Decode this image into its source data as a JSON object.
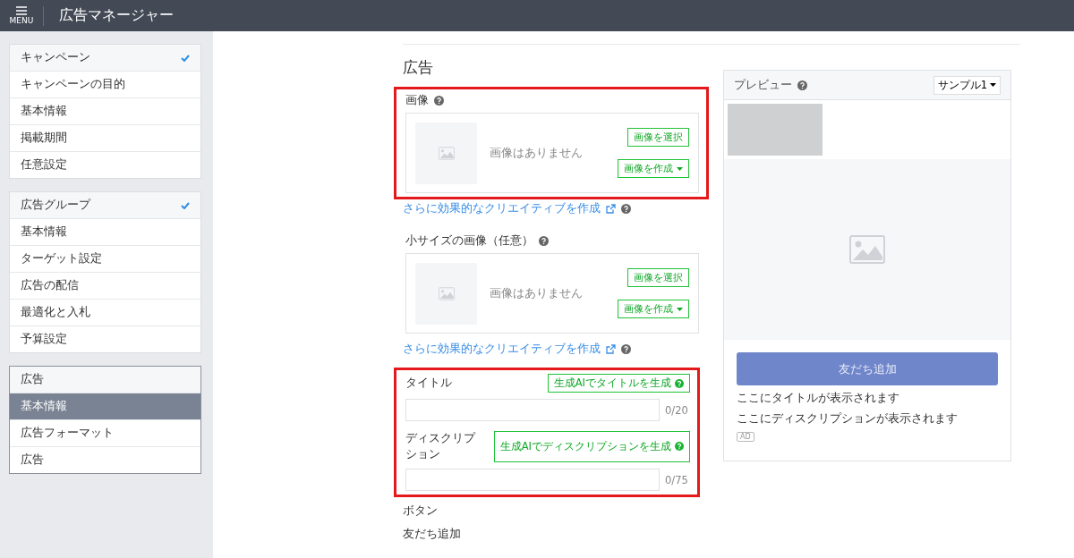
{
  "header": {
    "menu_label": "MENU",
    "title": "広告マネージャー"
  },
  "sidebar": {
    "groups": [
      {
        "title": "キャンペーン",
        "checked": true,
        "boxed": false,
        "items": [
          {
            "label": "キャンペーンの目的",
            "selected": false
          },
          {
            "label": "基本情報",
            "selected": false
          },
          {
            "label": "掲載期間",
            "selected": false
          },
          {
            "label": "任意設定",
            "selected": false
          }
        ]
      },
      {
        "title": "広告グループ",
        "checked": true,
        "boxed": false,
        "items": [
          {
            "label": "基本情報",
            "selected": false
          },
          {
            "label": "ターゲット設定",
            "selected": false
          },
          {
            "label": "広告の配信",
            "selected": false
          },
          {
            "label": "最適化と入札",
            "selected": false
          },
          {
            "label": "予算設定",
            "selected": false
          }
        ]
      },
      {
        "title": "広告",
        "checked": false,
        "boxed": true,
        "items": [
          {
            "label": "基本情報",
            "selected": true
          },
          {
            "label": "広告フォーマット",
            "selected": false
          },
          {
            "label": "広告",
            "selected": false
          }
        ]
      }
    ]
  },
  "form": {
    "heading": "広告",
    "image_sections": [
      {
        "label": "画像",
        "highlighted": true,
        "empty_text": "画像はありません",
        "select_button": "画像を選択",
        "create_button": "画像を作成",
        "link": "さらに効果的なクリエイティブを作成"
      },
      {
        "label": "小サイズの画像（任意）",
        "highlighted": false,
        "empty_text": "画像はありません",
        "select_button": "画像を選択",
        "create_button": "画像を作成",
        "link": "さらに効果的なクリエイティブを作成"
      }
    ],
    "text_group": {
      "highlighted": true,
      "fields": [
        {
          "label": "タイトル",
          "ai_button": "生成AIでタイトルを生成",
          "counter": "0/20"
        },
        {
          "label": "ディスクリプション",
          "ai_button": "生成AIでディスクリプションを生成",
          "counter": "0/75"
        }
      ]
    },
    "button_label": "ボタン",
    "button_value": "友だち追加"
  },
  "preview": {
    "title": "プレビュー",
    "sample": "サンプル1",
    "cta": "友だち追加",
    "title_text": "ここにタイトルが表示されます",
    "description_text": "ここにディスクリプションが表示されます",
    "ad_badge": "AD"
  }
}
